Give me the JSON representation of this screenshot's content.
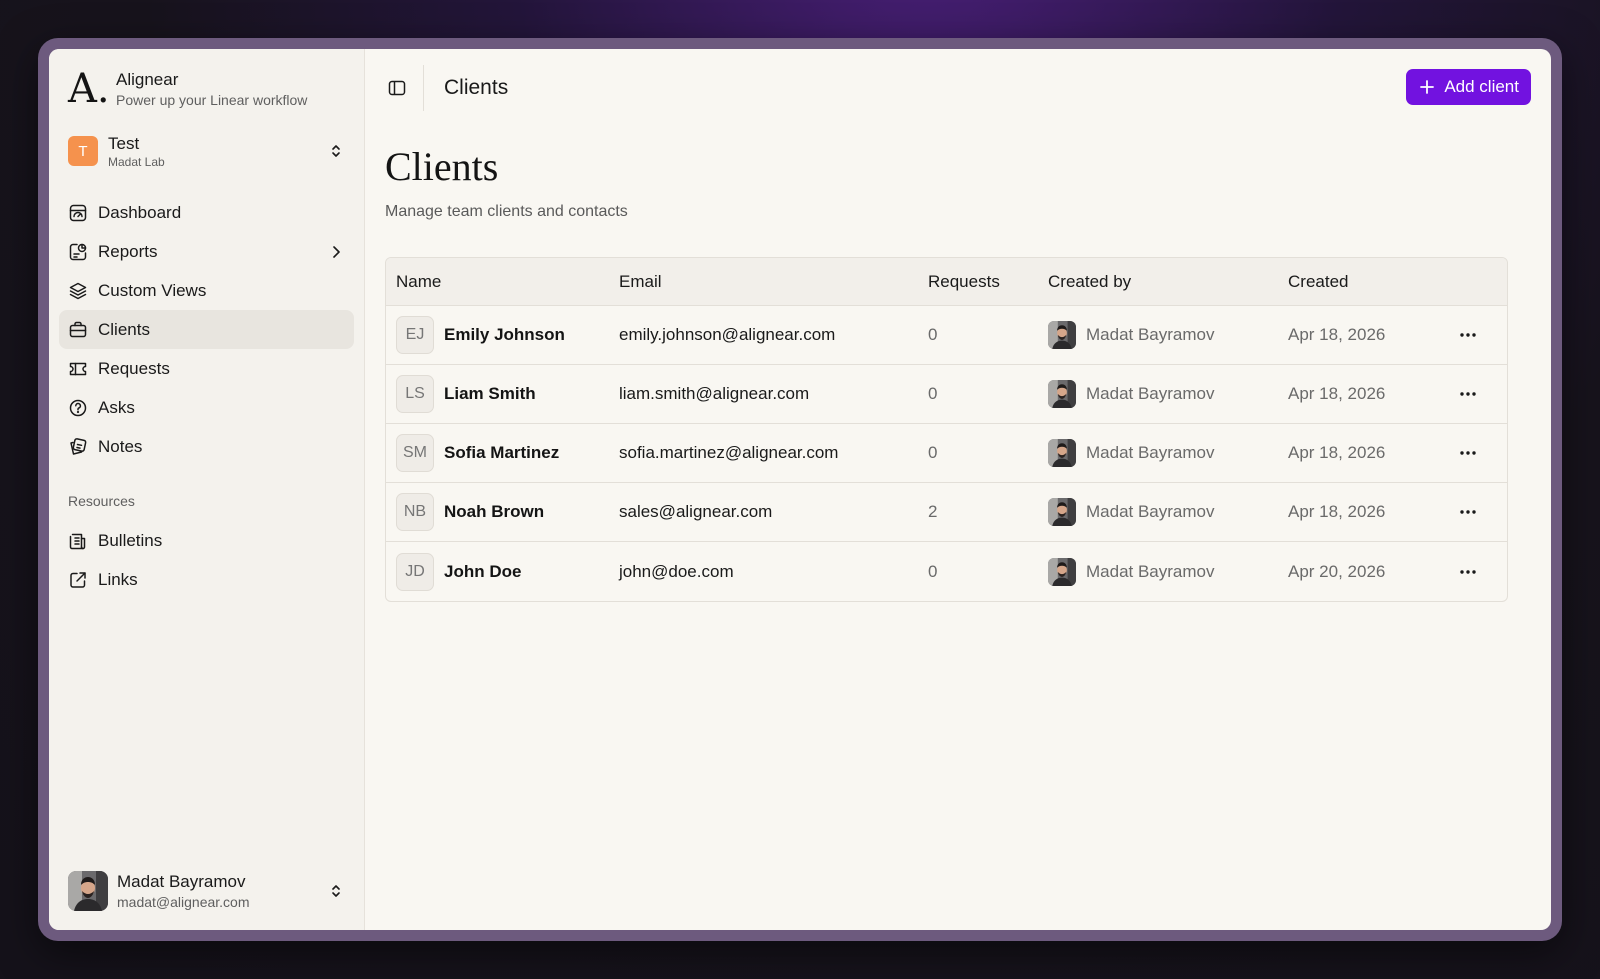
{
  "brand": {
    "logo": "A.",
    "name": "Alignear",
    "tagline": "Power up your Linear workflow"
  },
  "workspace": {
    "initial": "T",
    "name": "Test",
    "org": "Madat Lab",
    "color": "#F5924D"
  },
  "nav": [
    {
      "label": "Dashboard",
      "icon": "dashboard-icon"
    },
    {
      "label": "Reports",
      "icon": "reports-icon",
      "has_submenu": true
    },
    {
      "label": "Custom Views",
      "icon": "layers-icon"
    },
    {
      "label": "Clients",
      "icon": "briefcase-icon",
      "active": true
    },
    {
      "label": "Requests",
      "icon": "ticket-icon"
    },
    {
      "label": "Asks",
      "icon": "question-circle-icon"
    },
    {
      "label": "Notes",
      "icon": "notes-icon"
    }
  ],
  "resources": {
    "label": "Resources",
    "items": [
      {
        "label": "Bulletins",
        "icon": "newspaper-icon"
      },
      {
        "label": "Links",
        "icon": "external-link-icon"
      }
    ]
  },
  "user": {
    "name": "Madat Bayramov",
    "email": "madat@alignear.com"
  },
  "header": {
    "title": "Clients",
    "add_button": "Add client"
  },
  "page": {
    "title": "Clients",
    "subtitle": "Manage team clients and contacts"
  },
  "table": {
    "columns": [
      "Name",
      "Email",
      "Requests",
      "Created by",
      "Created"
    ],
    "rows": [
      {
        "initials": "EJ",
        "name": "Emily Johnson",
        "email": "emily.johnson@alignear.com",
        "requests": "0",
        "created_by": "Madat Bayramov",
        "created": "Apr 18, 2026"
      },
      {
        "initials": "LS",
        "name": "Liam Smith",
        "email": "liam.smith@alignear.com",
        "requests": "0",
        "created_by": "Madat Bayramov",
        "created": "Apr 18, 2026"
      },
      {
        "initials": "SM",
        "name": "Sofia Martinez",
        "email": "sofia.martinez@alignear.com",
        "requests": "0",
        "created_by": "Madat Bayramov",
        "created": "Apr 18, 2026"
      },
      {
        "initials": "NB",
        "name": "Noah Brown",
        "email": "sales@alignear.com",
        "requests": "2",
        "created_by": "Madat Bayramov",
        "created": "Apr 18, 2026"
      },
      {
        "initials": "JD",
        "name": "John Doe",
        "email": "john@doe.com",
        "requests": "0",
        "created_by": "Madat Bayramov",
        "created": "Apr 20, 2026"
      }
    ]
  },
  "colors": {
    "accent": "#7212E0",
    "background": "#F9F7F2",
    "sidebar": "#F4F2ED"
  }
}
